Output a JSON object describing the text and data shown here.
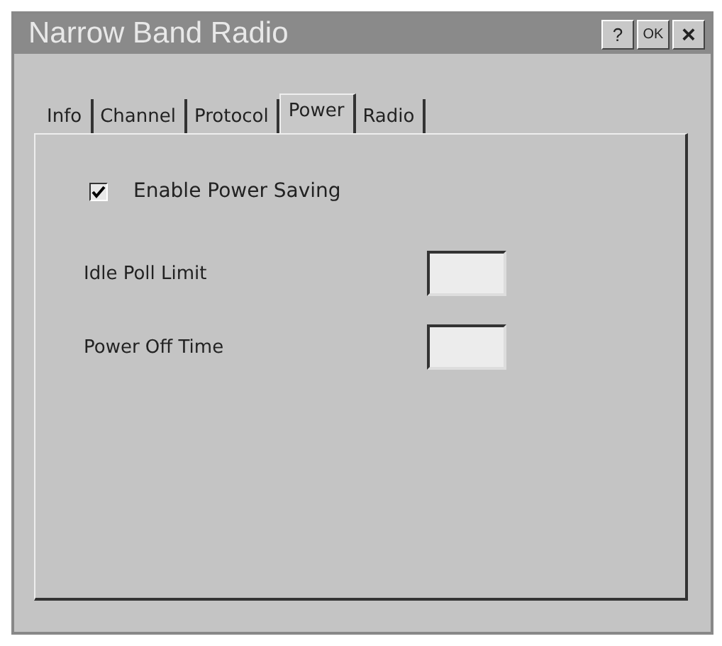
{
  "window": {
    "title": "Narrow Band Radio",
    "buttons": [
      {
        "kind": "help",
        "label": "?"
      },
      {
        "kind": "ok",
        "label": "OK"
      },
      {
        "kind": "close",
        "label": "×"
      }
    ]
  },
  "tabs": [
    {
      "label": "Info",
      "selected": false
    },
    {
      "label": "Channel",
      "selected": false
    },
    {
      "label": "Protocol",
      "selected": false
    },
    {
      "label": "Power",
      "selected": true
    },
    {
      "label": "Radio",
      "selected": false
    }
  ],
  "checkbox": {
    "label": "Enable Power Saving",
    "checked": true
  },
  "fields": [
    {
      "label": "Idle Poll Limit"
    },
    {
      "label": "Power Off Time"
    }
  ]
}
